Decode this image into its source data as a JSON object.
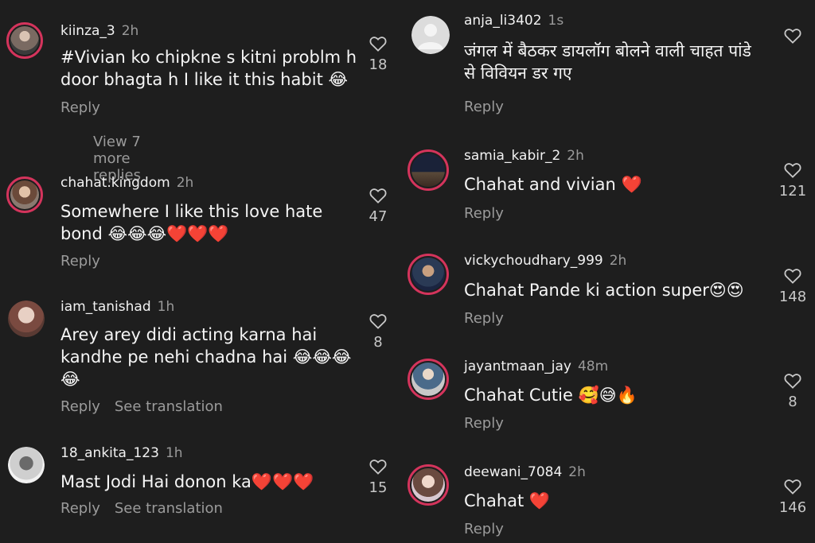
{
  "colors": {
    "background": "#1e1e1e",
    "story_ring": "#d4345c",
    "muted_text": "#9b9b9b"
  },
  "left_comments": [
    {
      "username": "kiinza_3",
      "time": "2h",
      "text": "#Vivian ko chipkne s kitni problm h door bhagta h I like it this habit 😂",
      "likes": "18",
      "reply": "Reply",
      "view_more": "View 7 more replies"
    },
    {
      "username": "chahat.kingdom",
      "time": "2h",
      "text": "Somewhere I like this love hate bond 😂😂😂❤️❤️❤️",
      "likes": "47",
      "reply": "Reply"
    },
    {
      "username": "iam_tanishad",
      "time": "1h",
      "text": "Arey arey didi acting karna hai kandhe pe nehi chadna hai 😂😂😂😂",
      "likes": "8",
      "reply": "Reply",
      "see_translation": "See translation"
    },
    {
      "username": "18_ankita_123",
      "time": "1h",
      "text": "Mast Jodi Hai donon ka❤️❤️❤️",
      "likes": "15",
      "reply": "Reply",
      "see_translation": "See translation"
    }
  ],
  "right_comments": [
    {
      "username": "anja_li3402",
      "time": "1s",
      "text": "जंगल में बैठकर डायलॉग बोलने वाली चाहत पांडे से विवियन डर गए",
      "reply": "Reply"
    },
    {
      "username": "samia_kabir_2",
      "time": "2h",
      "text": "Chahat and vivian ❤️",
      "likes": "121",
      "reply": "Reply"
    },
    {
      "username": "vickychoudhary_999",
      "time": "2h",
      "text": "Chahat Pande ki action super😍😍",
      "likes": "148",
      "reply": "Reply"
    },
    {
      "username": "jayantmaan_jay",
      "time": "48m",
      "text": "Chahat Cutie 🥰😅🔥",
      "likes": "8",
      "reply": "Reply"
    },
    {
      "username": "deewani_7084",
      "time": "2h",
      "text": "Chahat ❤️",
      "likes": "146",
      "reply": "Reply"
    }
  ]
}
